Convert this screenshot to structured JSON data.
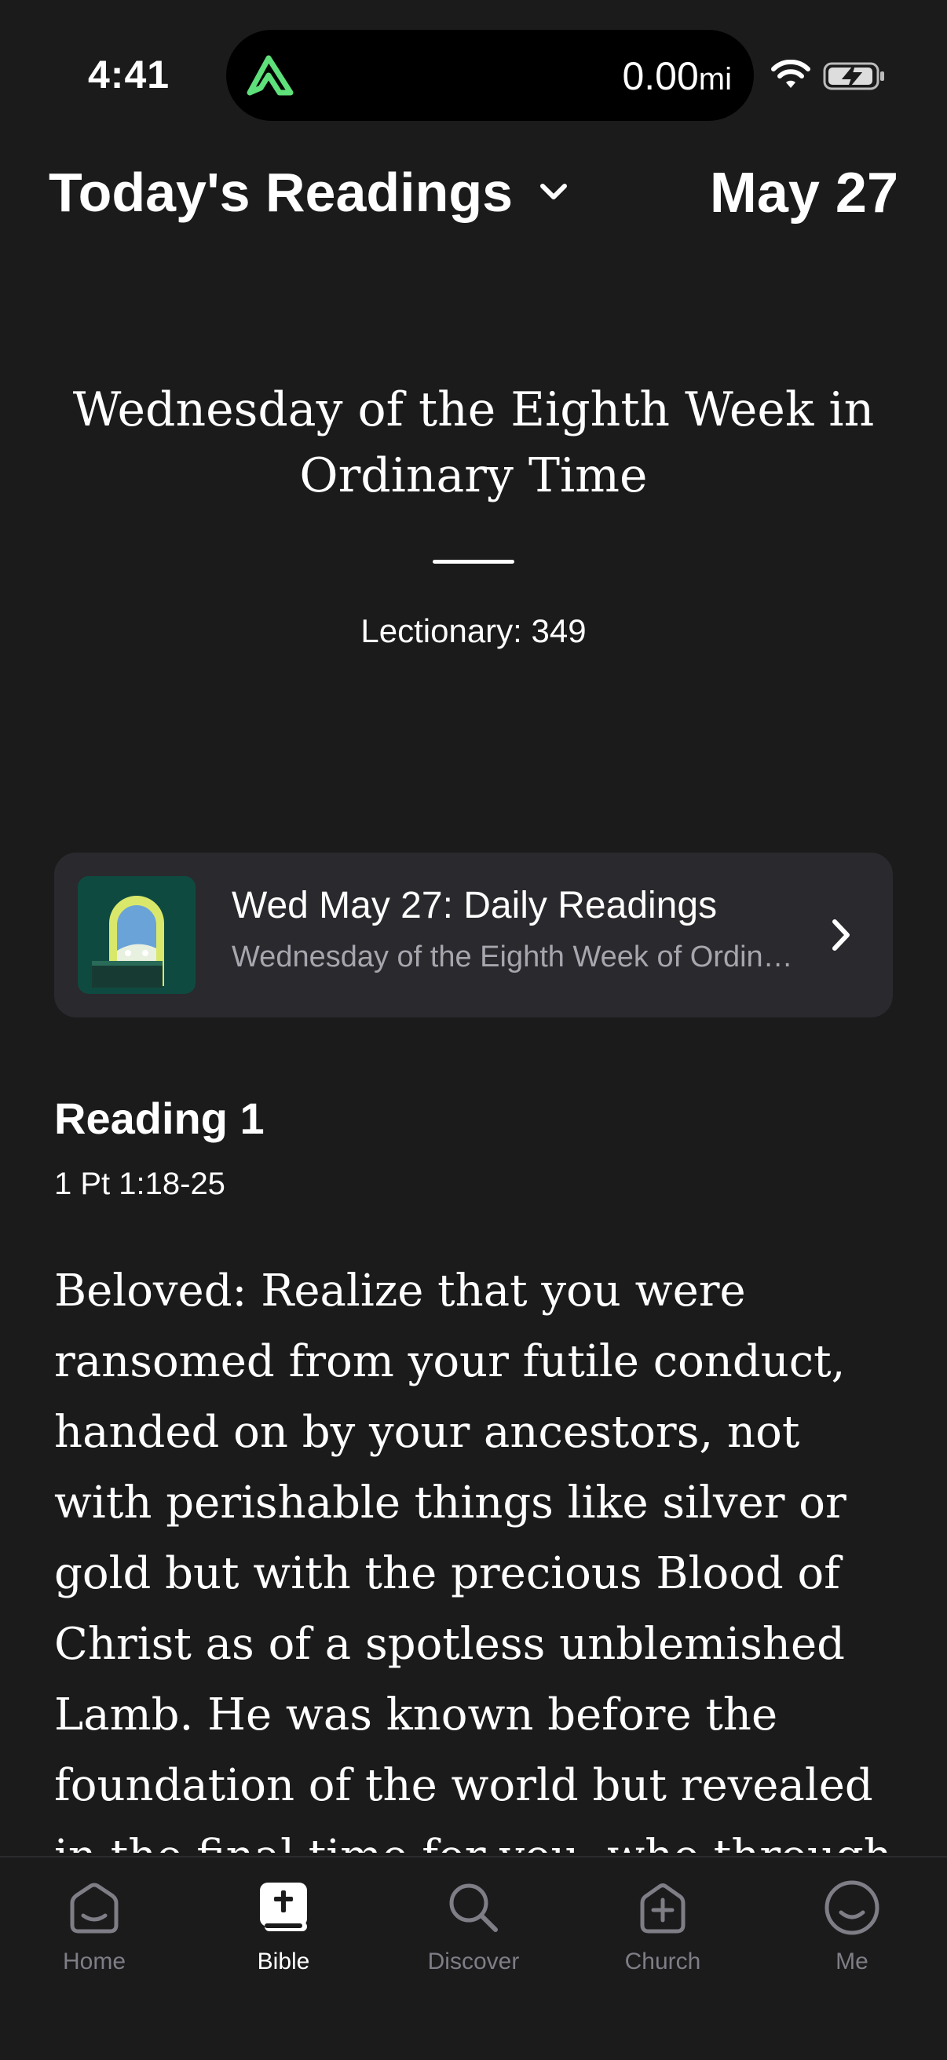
{
  "status_bar": {
    "time": "4:41",
    "distance_value": "0.00",
    "distance_unit": "mi",
    "accent_color": "#5ee07a"
  },
  "header": {
    "title": "Today's Readings",
    "date": "May 27"
  },
  "liturgy": {
    "day_title": "Wednesday of the Eighth Week in Ordinary Time",
    "lectionary": "Lectionary: 349"
  },
  "media_card": {
    "title": "Wed May 27: Daily Readings",
    "subtitle": "Wednesday of the Eighth Week of Ordinary Time"
  },
  "reading": {
    "label": "Reading 1",
    "reference": "1 Pt 1:18-25",
    "text": "Beloved: Realize that you were ransomed from your futile conduct, handed on by your ancestors, not with perishable things like silver or gold but with the precious Blood of Christ as of a spotless unblemished Lamb. He was known before the foundation of the world but revealed in the final time for you, who through"
  },
  "tab_bar": {
    "items": [
      {
        "label": "Home",
        "icon": "home-icon"
      },
      {
        "label": "Bible",
        "icon": "bible-icon",
        "active": true
      },
      {
        "label": "Discover",
        "icon": "search-icon"
      },
      {
        "label": "Church",
        "icon": "church-icon"
      },
      {
        "label": "Me",
        "icon": "profile-icon"
      }
    ]
  }
}
